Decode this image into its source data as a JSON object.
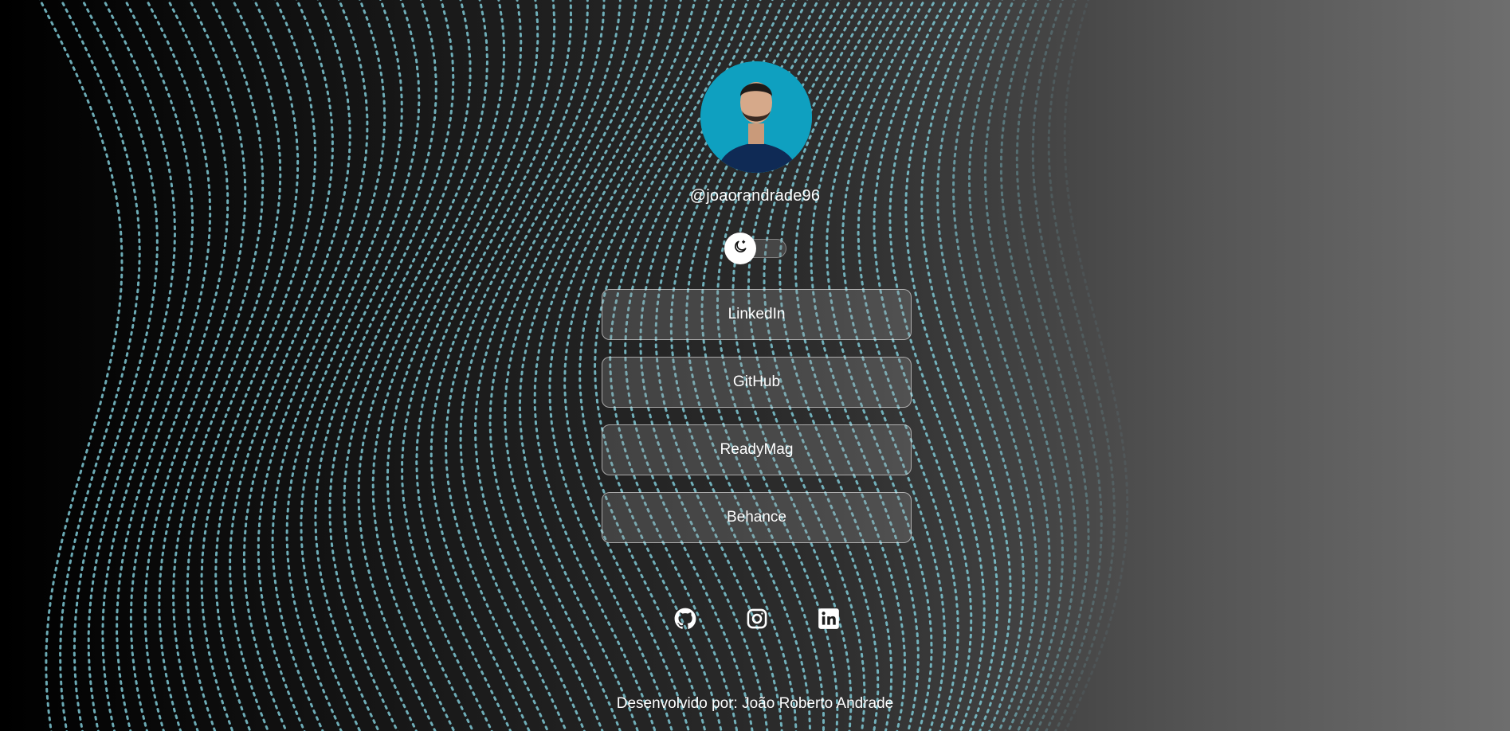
{
  "profile": {
    "username": "@joaorandrade96"
  },
  "theme_toggle": {
    "icon": "moon-icon"
  },
  "links": [
    {
      "label": "LinkedIn"
    },
    {
      "label": "GitHub"
    },
    {
      "label": "ReadyMag"
    },
    {
      "label": "Behance"
    }
  ],
  "socials": [
    {
      "icon": "github-icon"
    },
    {
      "icon": "instagram-icon"
    },
    {
      "icon": "linkedin-icon"
    }
  ],
  "footer": {
    "text": "Desenvolvido por: João Roberto Andrade"
  },
  "colors": {
    "wave_dots": "#7ec8d4",
    "avatar_bg": "#0f9fbf"
  }
}
